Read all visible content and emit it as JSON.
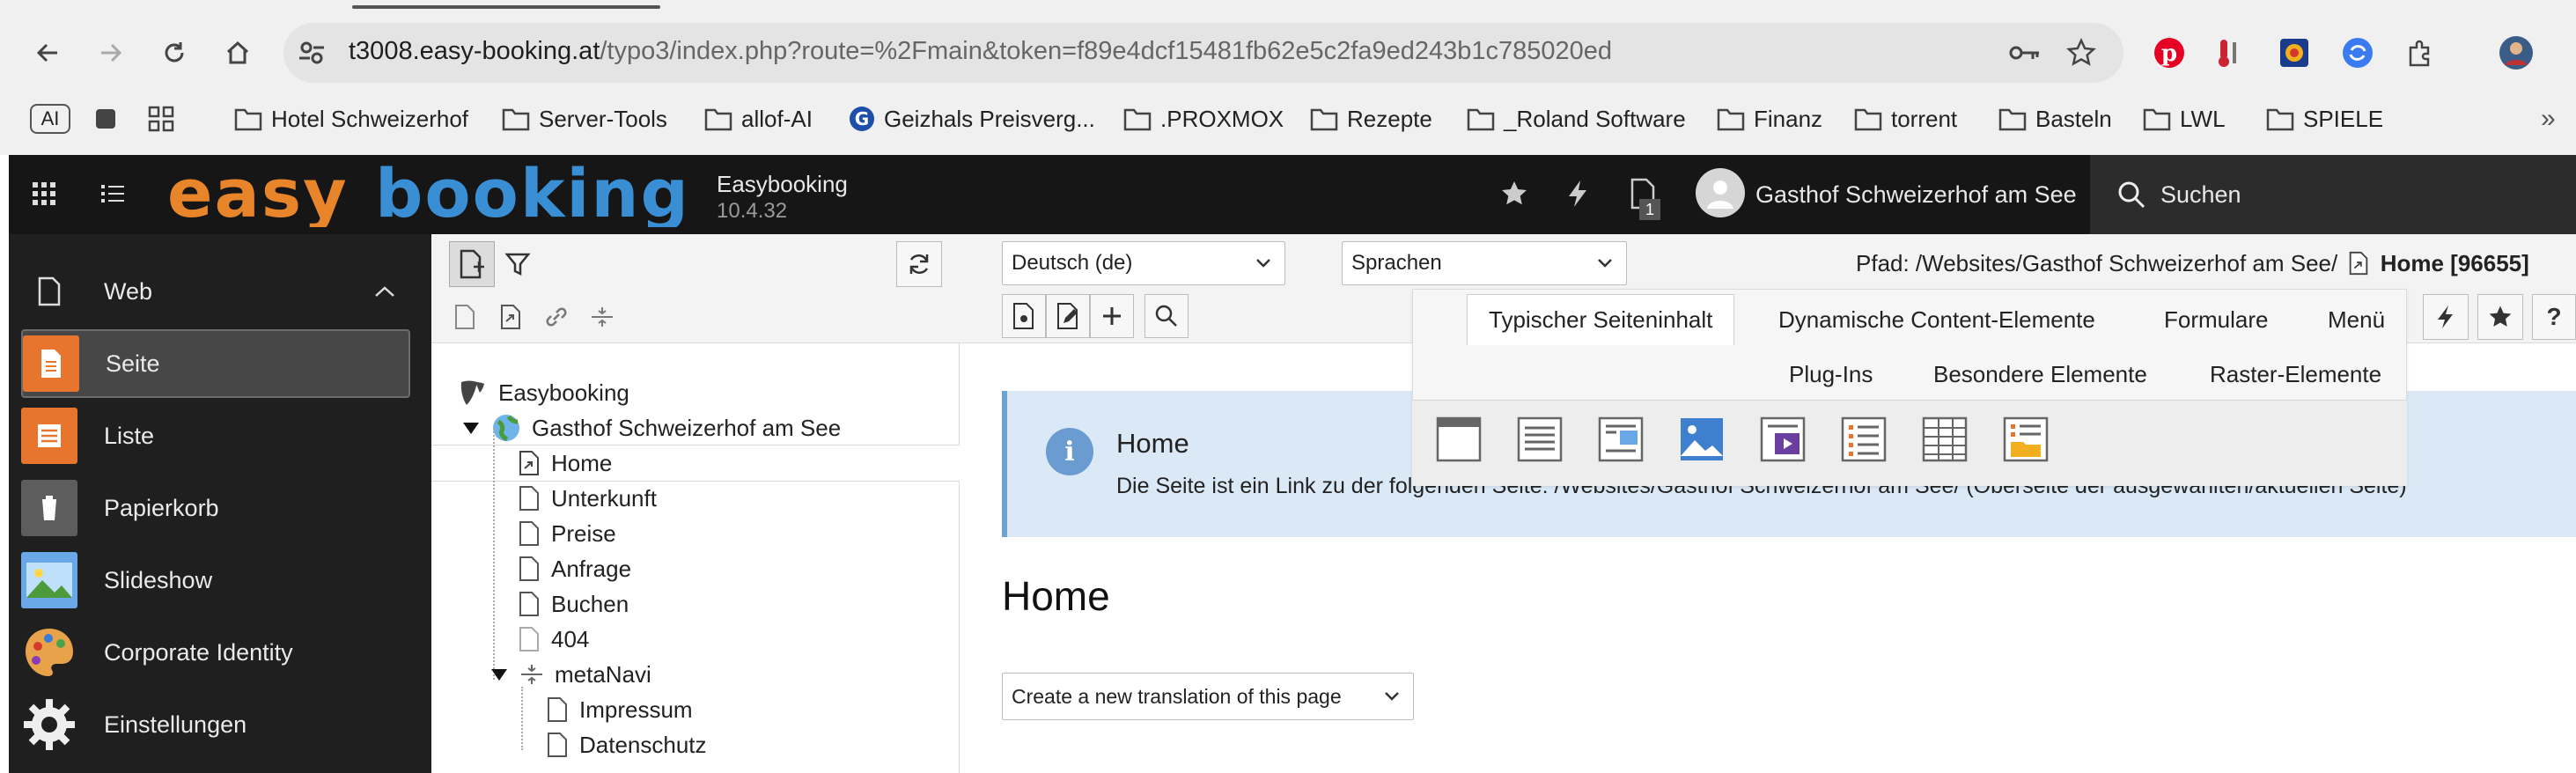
{
  "browser": {
    "url_host": "t3008.easy-booking.at",
    "url_rest": "/typo3/index.php?route=%2Fmain&token=f89e4dcf15481fb62e5c2fa9ed243b1c785020ed",
    "bookmarks": [
      {
        "label": "AI",
        "icon": "ai-badge-icon"
      },
      {
        "label": "",
        "icon": "square-icon"
      },
      {
        "label": "",
        "icon": "apps-grid-icon"
      },
      {
        "label": "Hotel Schweizerhof",
        "icon": "folder-icon"
      },
      {
        "label": "Server-Tools",
        "icon": "folder-icon"
      },
      {
        "label": "allof-AI",
        "icon": "folder-icon"
      },
      {
        "label": "Geizhals Preisverg...",
        "icon": "geizhals-icon"
      },
      {
        "label": ".PROXMOX",
        "icon": "folder-icon"
      },
      {
        "label": "Rezepte",
        "icon": "folder-icon"
      },
      {
        "label": "_Roland Software",
        "icon": "folder-icon"
      },
      {
        "label": "Finanz",
        "icon": "folder-icon"
      },
      {
        "label": "torrent",
        "icon": "folder-icon"
      },
      {
        "label": "Basteln",
        "icon": "folder-icon"
      },
      {
        "label": "LWL",
        "icon": "folder-icon"
      },
      {
        "label": "SPIELE",
        "icon": "folder-icon"
      }
    ],
    "more_bookmarks": "»"
  },
  "topbar": {
    "logo_part1": "easy",
    "logo_part2": "booking",
    "site_name": "Easybooking",
    "version": "10.4.32",
    "user": "Gasthof Schweizerhof am See",
    "badge_count": "1",
    "search_label": "Suchen"
  },
  "modules": {
    "group": "Web",
    "items": [
      {
        "label": "Seite"
      },
      {
        "label": "Liste"
      },
      {
        "label": "Papierkorb"
      },
      {
        "label": "Slideshow"
      },
      {
        "label": "Corporate Identity"
      },
      {
        "label": "Einstellungen"
      }
    ]
  },
  "tree": {
    "root": "Easybooking",
    "site": "Gasthof Schweizerhof am See",
    "pages": [
      "Home",
      "Unterkunft",
      "Preise",
      "Anfrage",
      "Buchen",
      "404"
    ],
    "folder": "metaNavi",
    "sub_pages": [
      "Impressum",
      "Datenschutz"
    ]
  },
  "content": {
    "language_select": "Deutsch (de)",
    "languages_select": "Sprachen",
    "breadcrumb_prefix": "Pfad: /Websites/Gasthof Schweizerhof am See/",
    "breadcrumb_page": "Home [96655]",
    "wizard_tabs": [
      "Typischer Seiteninhalt",
      "Dynamische Content-Elemente",
      "Formulare",
      "Menü",
      "Plug-Ins",
      "Besondere Elemente",
      "Raster-Elemente"
    ],
    "info_title": "Home",
    "info_text": "Die Seite ist ein Link zu der folgenden Seite: /Websites/Gasthof Schweizerhof am See/ (Oberseite der ausgewählten/aktuellen Seite)",
    "page_heading": "Home",
    "translation_select": "Create a new translation of this page"
  },
  "colors": {
    "logo_orange": "#e8852b",
    "logo_blue": "#3a8fd4",
    "module_seite": "#e8752d",
    "module_liste": "#e8752d"
  }
}
